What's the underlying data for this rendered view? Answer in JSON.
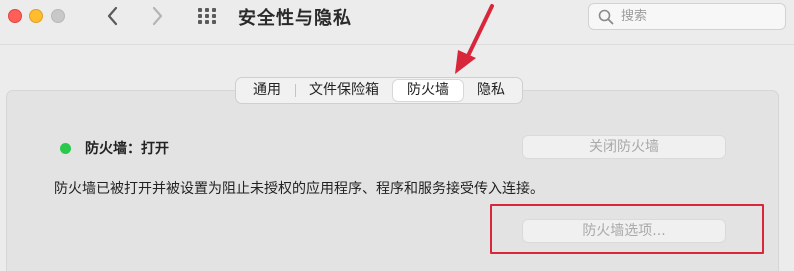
{
  "window": {
    "title": "安全性与隐私"
  },
  "search": {
    "placeholder": "搜索"
  },
  "tabs": [
    {
      "label": "通用",
      "active": false
    },
    {
      "label": "文件保险箱",
      "active": false
    },
    {
      "label": "防火墙",
      "active": true
    },
    {
      "label": "隐私",
      "active": false
    }
  ],
  "firewall": {
    "status_label": "防火墙：打开",
    "status_color": "#2ac84c",
    "turn_off_button": "关闭防火墙",
    "description": "防火墙已被打开并被设置为阻止未授权的应用程序、程序和服务接受传入连接。",
    "options_button": "防火墙选项..."
  },
  "annotations": {
    "arrow_color": "#d8263a",
    "highlight_color": "#d8263a"
  },
  "icons": {
    "close": "close-button",
    "minimize": "minimize-button",
    "zoom": "zoom-button",
    "back": "chevron-left-icon",
    "forward": "chevron-right-icon",
    "show_all": "grid-icon",
    "search": "magnifier-icon"
  }
}
